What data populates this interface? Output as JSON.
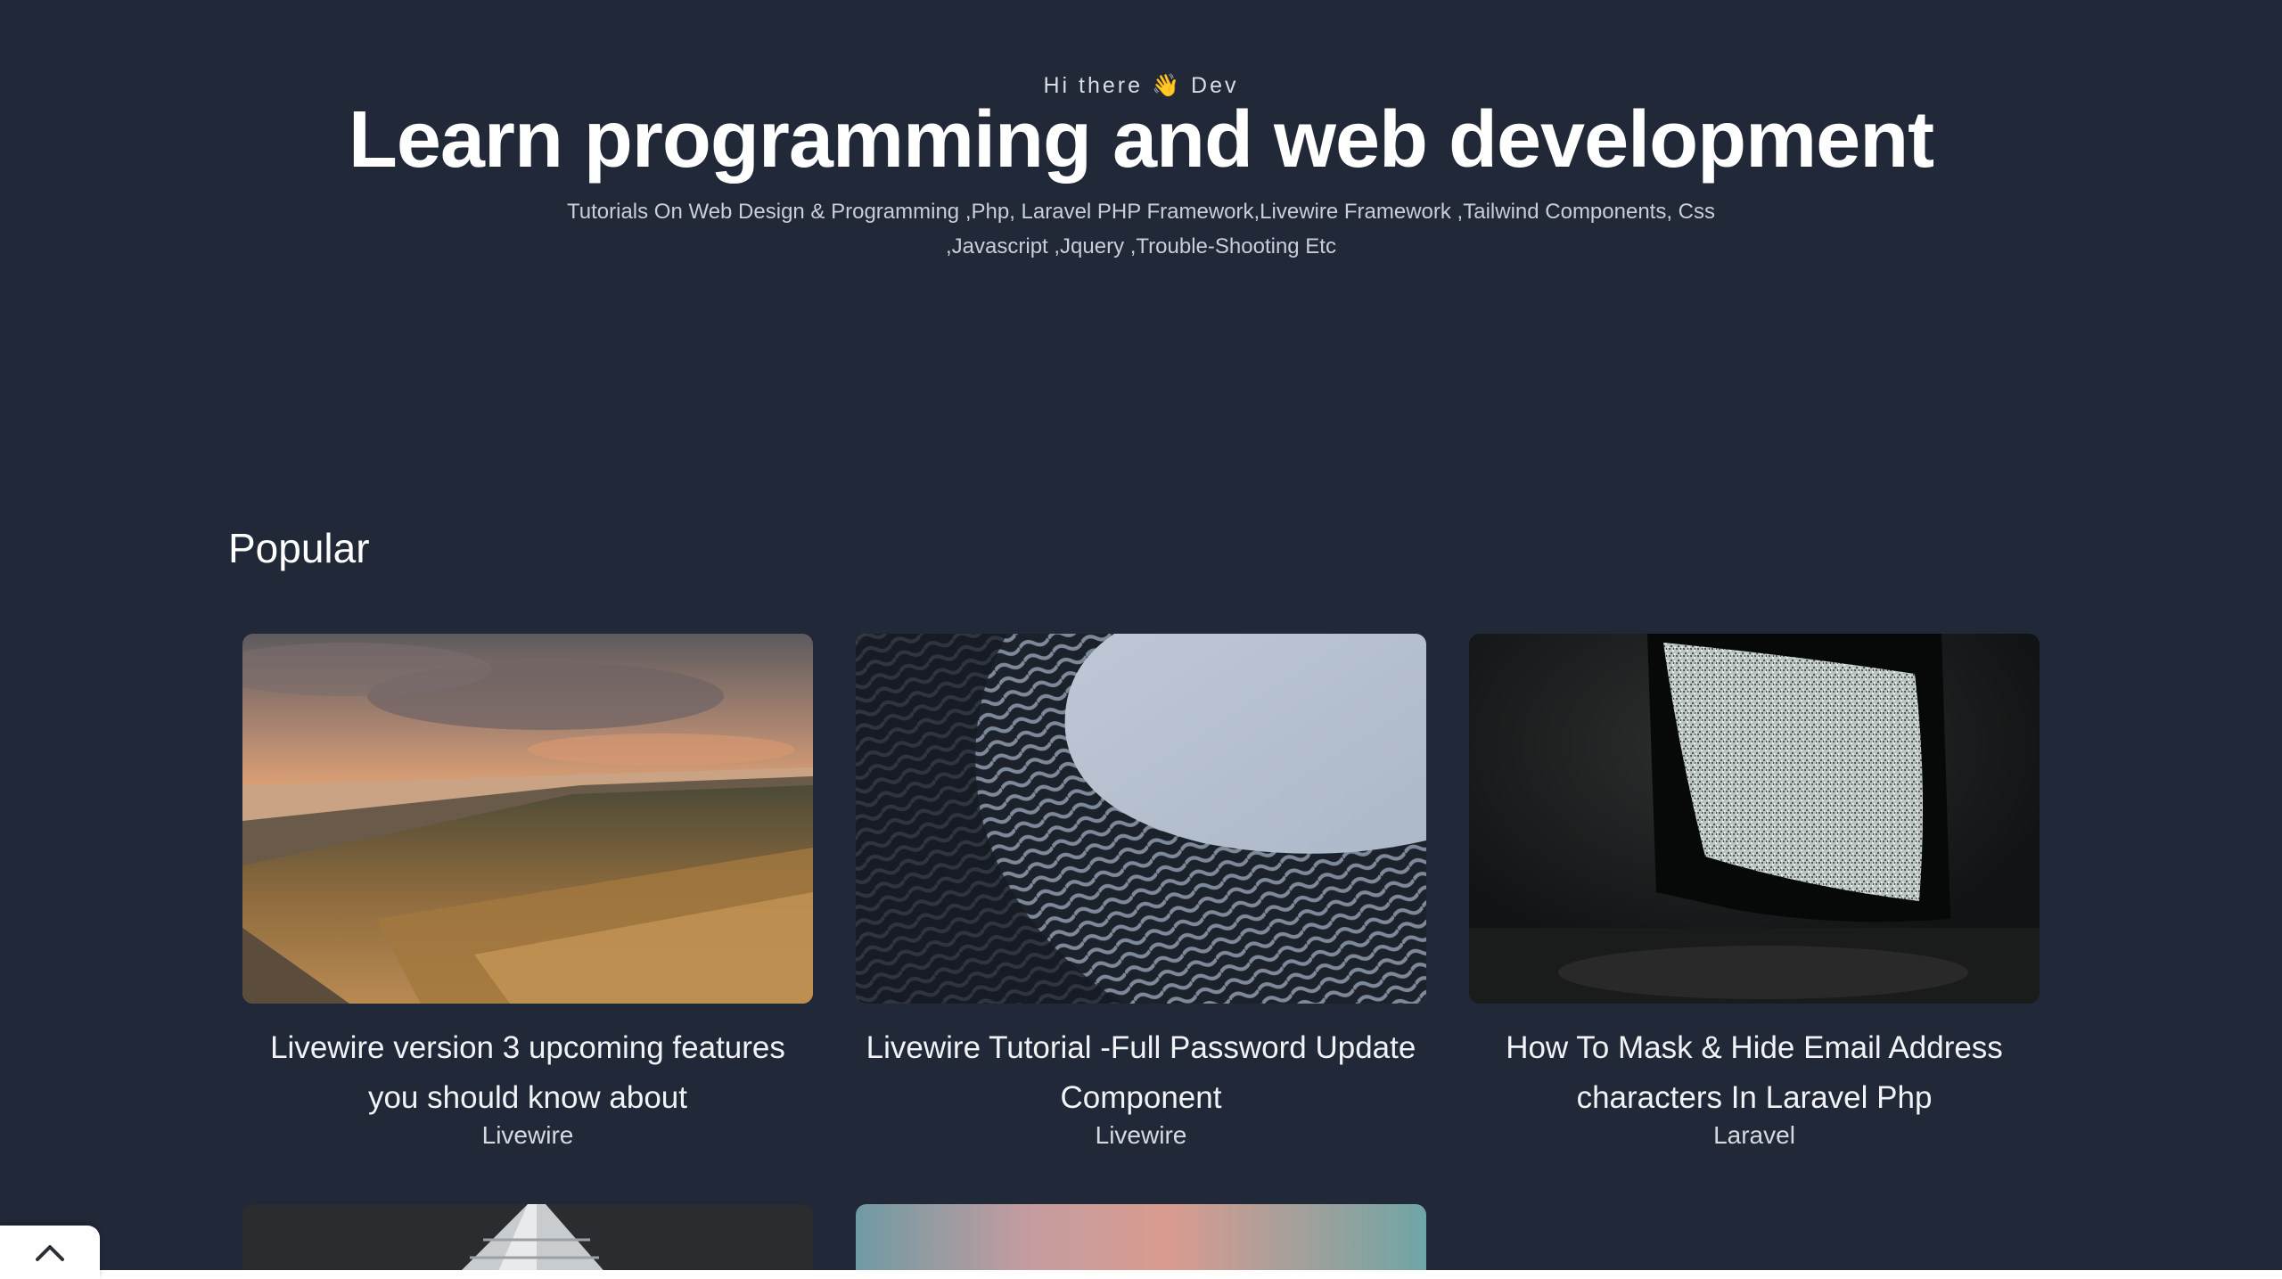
{
  "hero": {
    "greeting": "Hi there 👋 Dev",
    "title": "Learn programming and web development",
    "subtitle": "Tutorials On Web Design & Programming ,Php, Laravel PHP Framework,Livewire Framework ,Tailwind Components, Css ,Javascript ,Jquery ,Trouble-Shooting Etc"
  },
  "popular": {
    "heading": "Popular",
    "posts": [
      {
        "title": "Livewire version 3 upcoming features you should know about",
        "category": "Livewire",
        "image": "beach-dunes-sunset-photo"
      },
      {
        "title": "Livewire Tutorial -Full Password Update Component",
        "category": "Livewire",
        "image": "architecture-facade-photo"
      },
      {
        "title": "How To Mask & Hide Email Address characters In Laravel Php",
        "category": "Laravel",
        "image": "tv-static-photo"
      }
    ],
    "partial_posts": [
      {
        "image": "building-corner-photo"
      },
      {
        "image": "pastel-sky-photo"
      }
    ]
  },
  "scroll_top": {
    "icon": "chevron-up-icon"
  },
  "colors": {
    "background": "#212837",
    "text": "#ffffff",
    "muted_text": "#c9ced8"
  }
}
